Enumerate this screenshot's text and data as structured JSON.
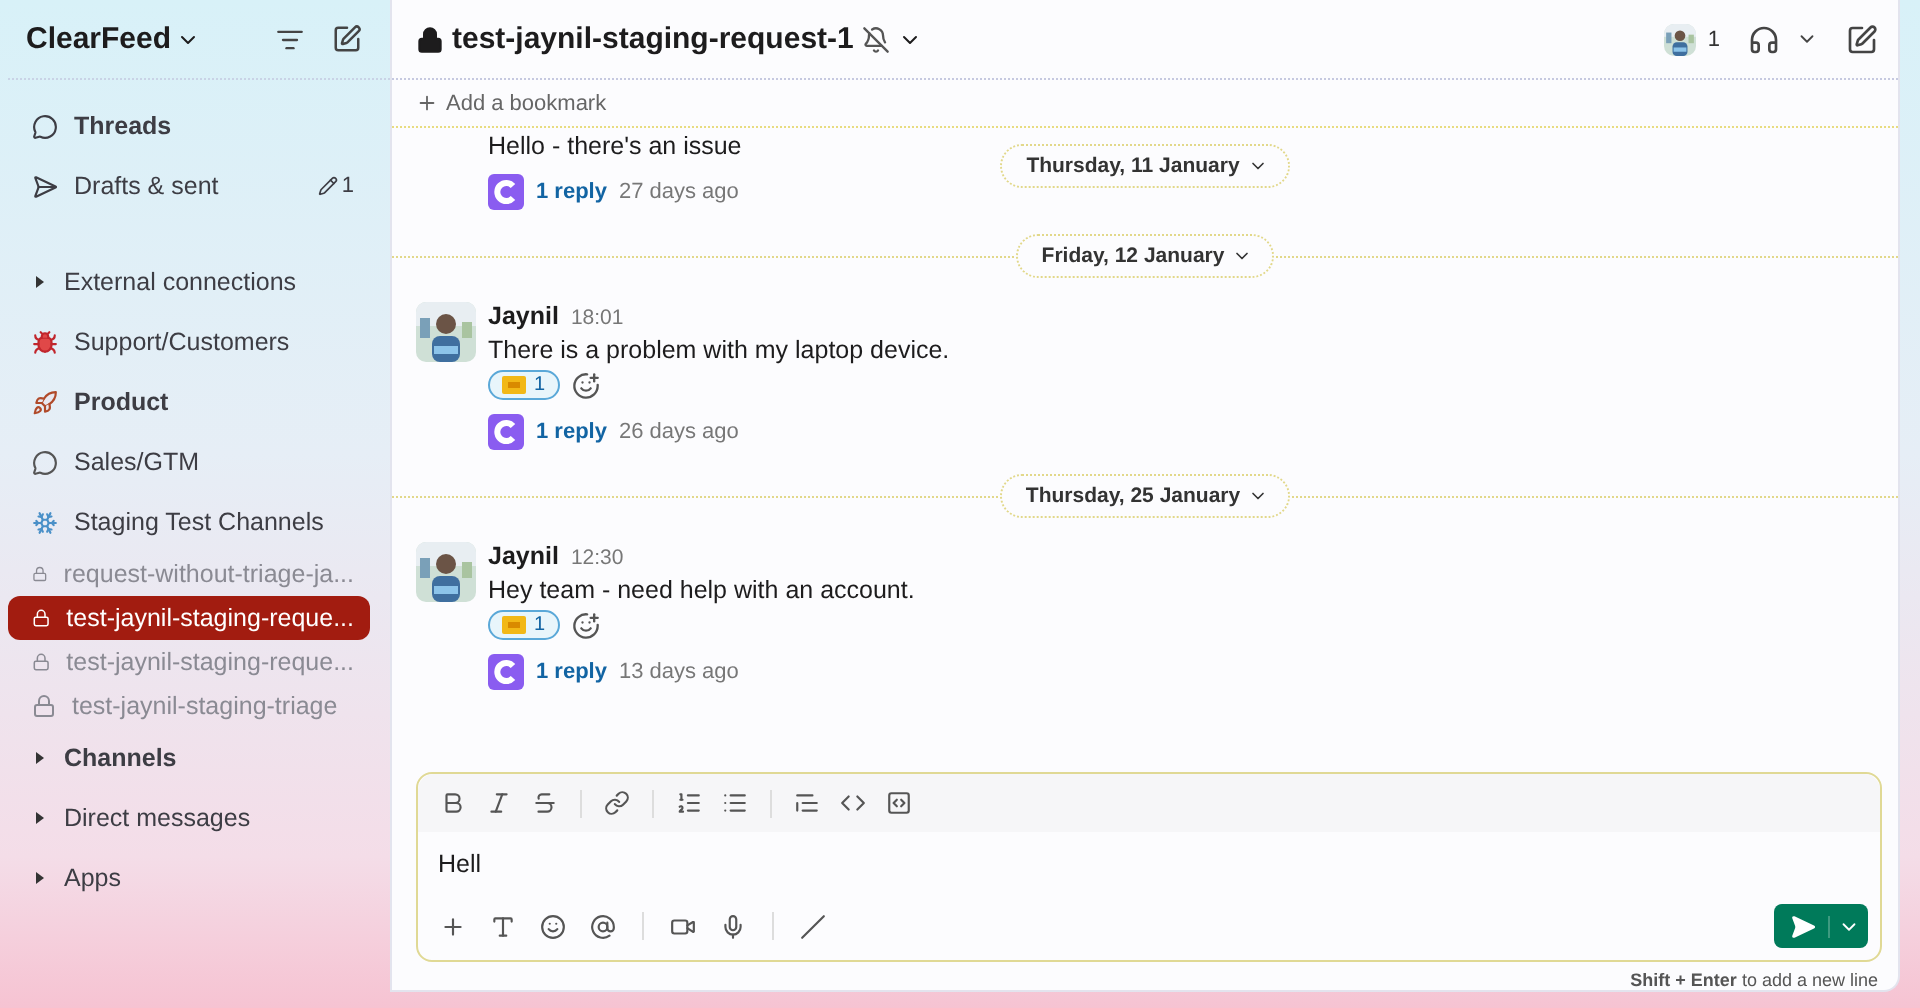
{
  "workspace": {
    "name": "ClearFeed"
  },
  "sidebar": {
    "items": [
      {
        "kind": "nav",
        "label": "Threads",
        "unread": true
      },
      {
        "kind": "nav",
        "label": "Drafts & sent",
        "unread": false,
        "badge": "1"
      },
      {
        "kind": "gap"
      },
      {
        "kind": "section",
        "label": "External connections",
        "unread": false
      },
      {
        "kind": "group",
        "label": "Support/Customers",
        "unread": false
      },
      {
        "kind": "group",
        "label": "Product",
        "unread": true
      },
      {
        "kind": "group",
        "label": "Sales/GTM",
        "unread": false
      },
      {
        "kind": "group",
        "label": "Staging Test Channels",
        "unread": false
      },
      {
        "kind": "channel",
        "label": "request-without-triage-ja...",
        "selected": false,
        "muted": true
      },
      {
        "kind": "channel",
        "label": "test-jaynil-staging-reque...",
        "selected": true,
        "muted": false
      },
      {
        "kind": "channel",
        "label": "test-jaynil-staging-reque...",
        "selected": false,
        "muted": true
      },
      {
        "kind": "channel",
        "label": "test-jaynil-staging-triage",
        "selected": false,
        "muted": true
      },
      {
        "kind": "section",
        "label": "Channels",
        "unread": true
      },
      {
        "kind": "section",
        "label": "Direct messages",
        "unread": false
      },
      {
        "kind": "section",
        "label": "Apps",
        "unread": false
      }
    ]
  },
  "channel": {
    "name": "test-jaynil-staging-request-1",
    "private": true,
    "notifications_muted": true,
    "member_count": "1"
  },
  "bookmark": {
    "label": "Add a bookmark"
  },
  "sticky_date": "Thursday, 11 January",
  "messages": [
    {
      "kind": "message",
      "text": "Hello - there's an issue",
      "reply_count": "1 reply",
      "reply_age": "27 days ago"
    },
    {
      "kind": "date",
      "label": "Friday, 12 January"
    },
    {
      "kind": "message",
      "author": "Jaynil",
      "time": "18:01",
      "text": "There is a problem with my laptop device.",
      "reactions": [
        {
          "count": "1",
          "selected": true
        }
      ],
      "reply_count": "1 reply",
      "reply_age": "26 days ago"
    },
    {
      "kind": "date",
      "label": "Thursday, 25 January"
    },
    {
      "kind": "message",
      "author": "Jaynil",
      "time": "12:30",
      "text": "Hey team - need help with an account.",
      "reactions": [
        {
          "count": "1",
          "selected": true
        }
      ],
      "reply_count": "1 reply",
      "reply_age": "13 days ago"
    }
  ],
  "composer": {
    "value": "Hell",
    "hint": "**Shift + Enter** to add a new line"
  }
}
